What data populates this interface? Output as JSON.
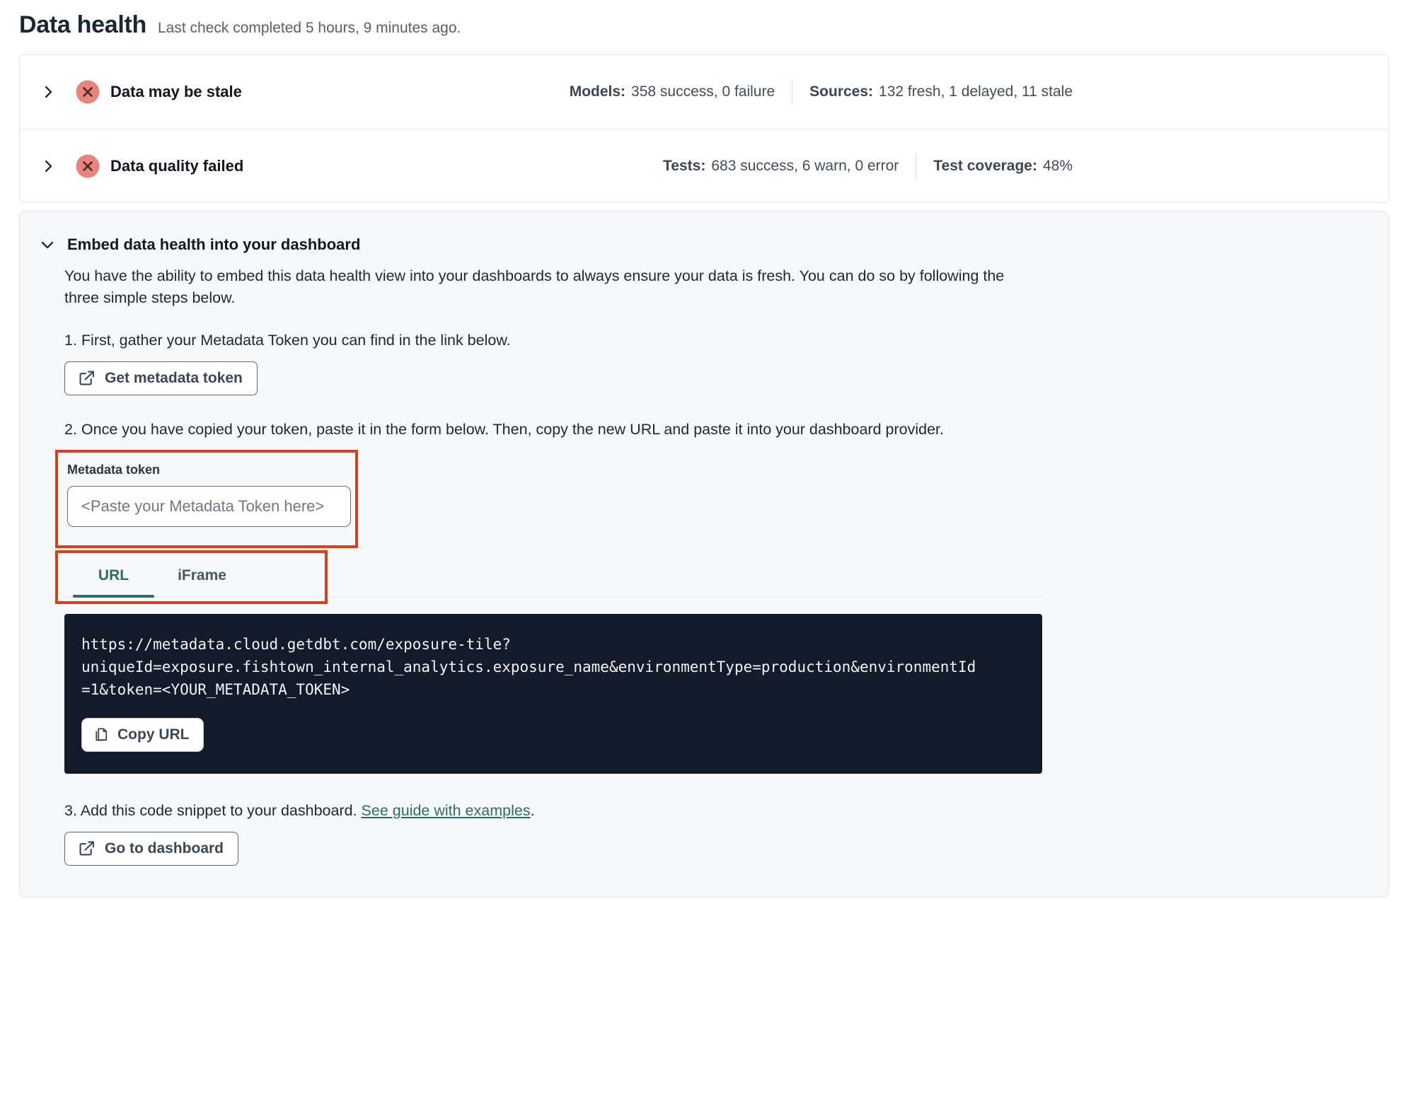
{
  "page": {
    "title": "Data health",
    "subtitle": "Last check completed 5 hours, 9 minutes ago."
  },
  "status_rows": [
    {
      "title": "Data may be stale",
      "status_icon": "error-x-circle",
      "stats": [
        {
          "label": "Models:",
          "value": "358 success, 0 failure"
        },
        {
          "label": "Sources:",
          "value": "132 fresh, 1 delayed, 11 stale"
        }
      ]
    },
    {
      "title": "Data quality failed",
      "status_icon": "error-x-circle",
      "stats": [
        {
          "label": "Tests:",
          "value": "683 success, 6 warn, 0 error"
        },
        {
          "label": "Test coverage:",
          "value": "48%"
        }
      ]
    }
  ],
  "embed": {
    "title": "Embed data health into your dashboard",
    "description": "You have the ability to embed this data health view into your dashboards to always ensure your data is fresh. You can do so by following the three simple steps below.",
    "step1": "1. First, gather your Metadata Token you can find in the link below.",
    "get_token_button": "Get metadata token",
    "step2": "2. Once you have copied your token, paste it in the form below. Then, copy the new URL and paste it into your dashboard provider.",
    "token_field": {
      "label": "Metadata token",
      "value": "",
      "placeholder": "<Paste your Metadata Token here>"
    },
    "tabs": [
      {
        "label": "URL",
        "active": true
      },
      {
        "label": "iFrame",
        "active": false
      }
    ],
    "code_lines": {
      "line1": "https://metadata.cloud.getdbt.com/exposure-tile?",
      "line2": "uniqueId=exposure.fishtown_internal_analytics.exposure_name&environmentType=production&environmentId",
      "line3": "=1&token=<YOUR_METADATA_TOKEN>"
    },
    "copy_button": "Copy URL",
    "step3_prefix": "3. Add this code snippet to your dashboard. ",
    "step3_link": "See guide with examples",
    "step3_suffix": ".",
    "dashboard_button": "Go to dashboard"
  },
  "colors": {
    "annotation_red": "#d4411f",
    "error_badge_bg": "#e5857d",
    "error_badge_x": "#4c2824",
    "accent_teal": "#2c6b66",
    "code_bg": "#131a2a",
    "section_bg": "#f7f8fa"
  }
}
